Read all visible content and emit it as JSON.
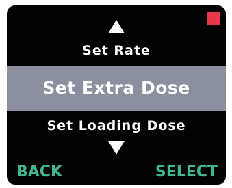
{
  "screen": {
    "status_indicator_color": "#e8364a",
    "up_arrow_icon": "triangle-up",
    "down_arrow_icon": "triangle-down"
  },
  "menu": {
    "previous_item": "Set Rate",
    "selected_item": "Set Extra Dose",
    "next_item": "Set Loading Dose",
    "highlight_color": "#8c8f9e"
  },
  "softkeys": {
    "back_label": "BACK",
    "select_label": "SELECT",
    "color": "#3fb78f"
  }
}
